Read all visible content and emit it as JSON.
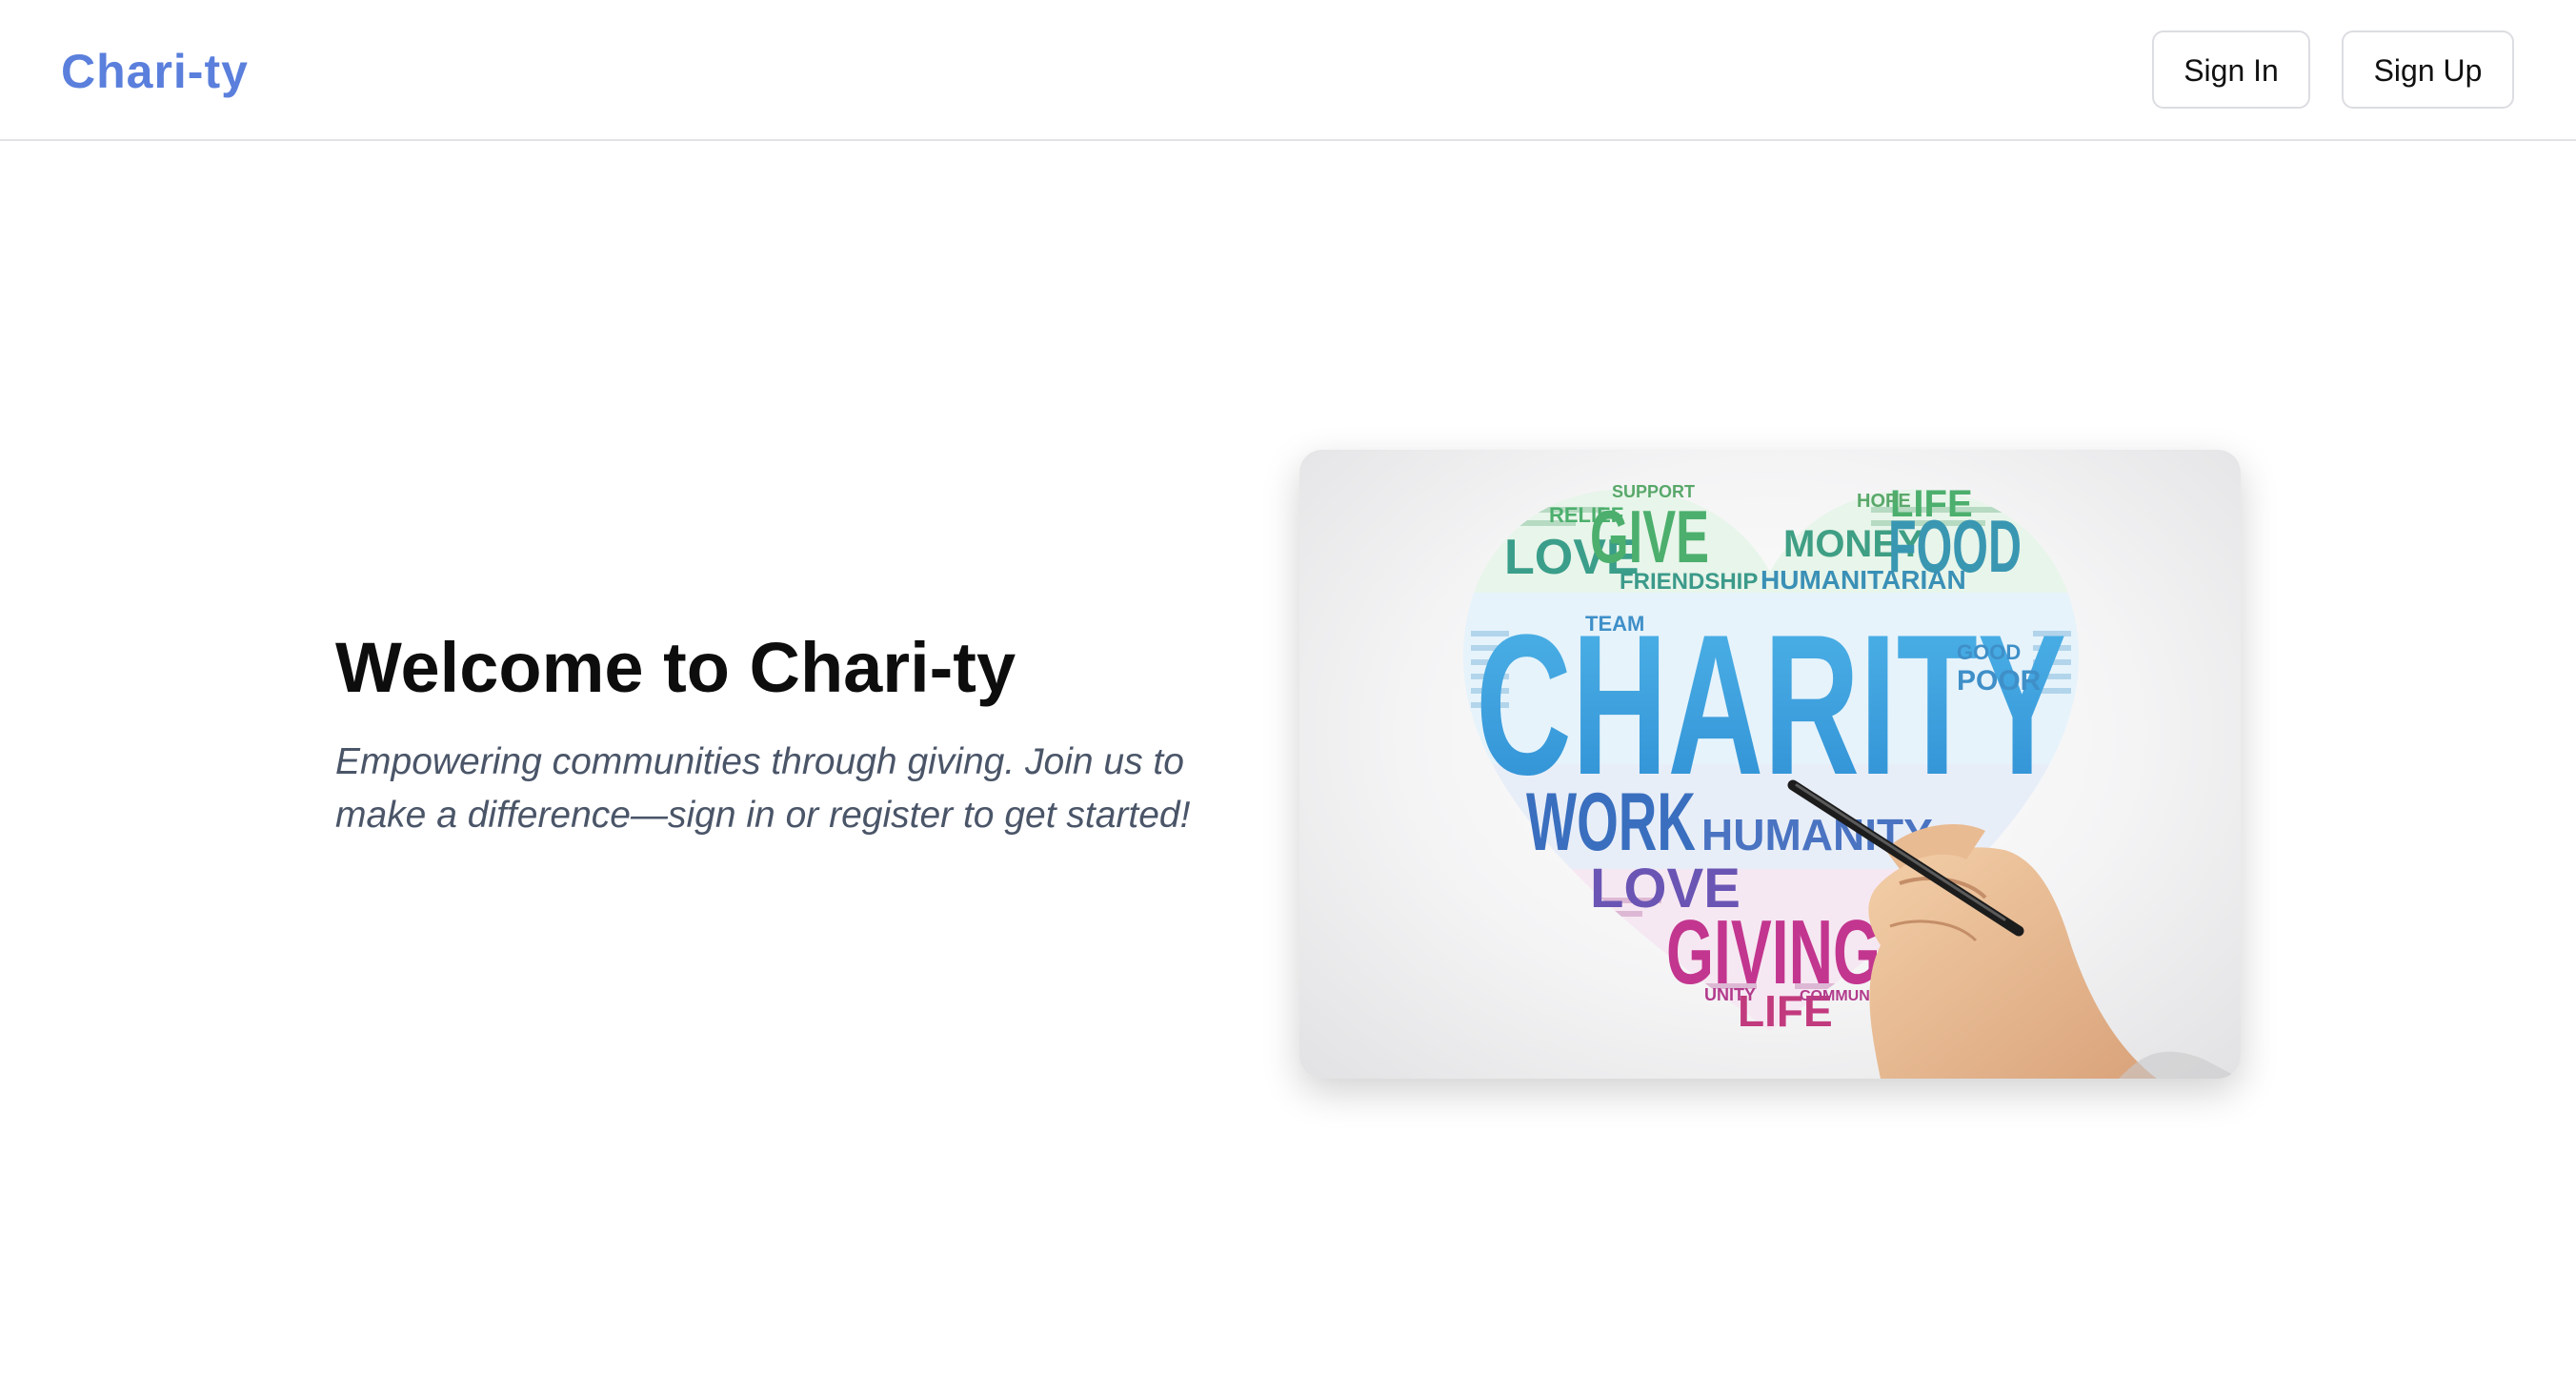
{
  "header": {
    "brand": "Chari-ty",
    "sign_in_label": "Sign In",
    "sign_up_label": "Sign Up"
  },
  "hero": {
    "title": "Welcome to Chari-ty",
    "subtitle": "Empowering communities through giving. Join us to make a difference—sign in or register to get started!"
  },
  "image": {
    "words": {
      "charity": "CHARITY",
      "give": "GIVE",
      "love": "LOVE",
      "money": "MONEY",
      "food": "FOOD",
      "friendship": "FRIENDSHIP",
      "humanitarian": "HUMANITARIAN",
      "work": "WORK",
      "humanity": "HUMANITY",
      "love2": "LOVE",
      "giving": "GIVING",
      "life": "LIFE",
      "life2": "LIFE",
      "support": "SUPPORT",
      "relief": "RELIEF",
      "hope": "HOPE",
      "team": "TEAM",
      "good": "GOOD",
      "poor": "POOR",
      "unity": "UNITY",
      "community": "COMMUNITY"
    }
  },
  "colors": {
    "brand": "#5a7fdc",
    "subtitle": "#4a5568",
    "border": "#dcdde2"
  }
}
